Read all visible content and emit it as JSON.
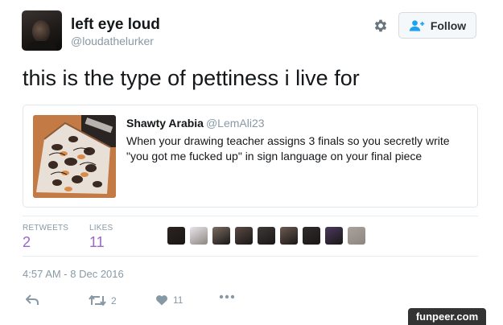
{
  "author": {
    "name": "left eye loud",
    "handle": "@loudathelurker"
  },
  "actions_header": {
    "settings_icon": "gear-icon",
    "follow_label": "Follow",
    "follow_icon": "add-user-icon"
  },
  "tweet": {
    "text": "this is the type of pettiness i live for"
  },
  "quoted_tweet": {
    "name": "Shawty Arabia",
    "handle": "@LemAli23",
    "text": "When your drawing teacher assigns 3 finals so you secretly write \"you got me fucked up\" in sign language on your final piece"
  },
  "stats": {
    "retweets_label": "RETWEETS",
    "retweets_value": "2",
    "likes_label": "LIKES",
    "likes_value": "11"
  },
  "likers": [
    {
      "color": "#2b2420"
    },
    {
      "color": "#e9e4ea"
    },
    {
      "color": "#7a6c61"
    },
    {
      "color": "#5a4a44"
    },
    {
      "color": "#3d3936"
    },
    {
      "color": "#6d5a52"
    },
    {
      "color": "#2f2c2b"
    },
    {
      "color": "#4b3a5e"
    },
    {
      "color": "#a8a39c"
    }
  ],
  "timestamp": "4:57 AM - 8 Dec 2016",
  "action_bar": {
    "reply_icon": "reply-icon",
    "retweet_icon": "retweet-icon",
    "retweet_count": "2",
    "like_icon": "heart-icon",
    "like_count": "11",
    "more_icon": "more-icon"
  },
  "watermark": "funpeer.com",
  "colors": {
    "accent": "#1da1f2",
    "stat_value": "#9a66cc",
    "muted": "#8899a6",
    "border": "#e1e8ed"
  }
}
